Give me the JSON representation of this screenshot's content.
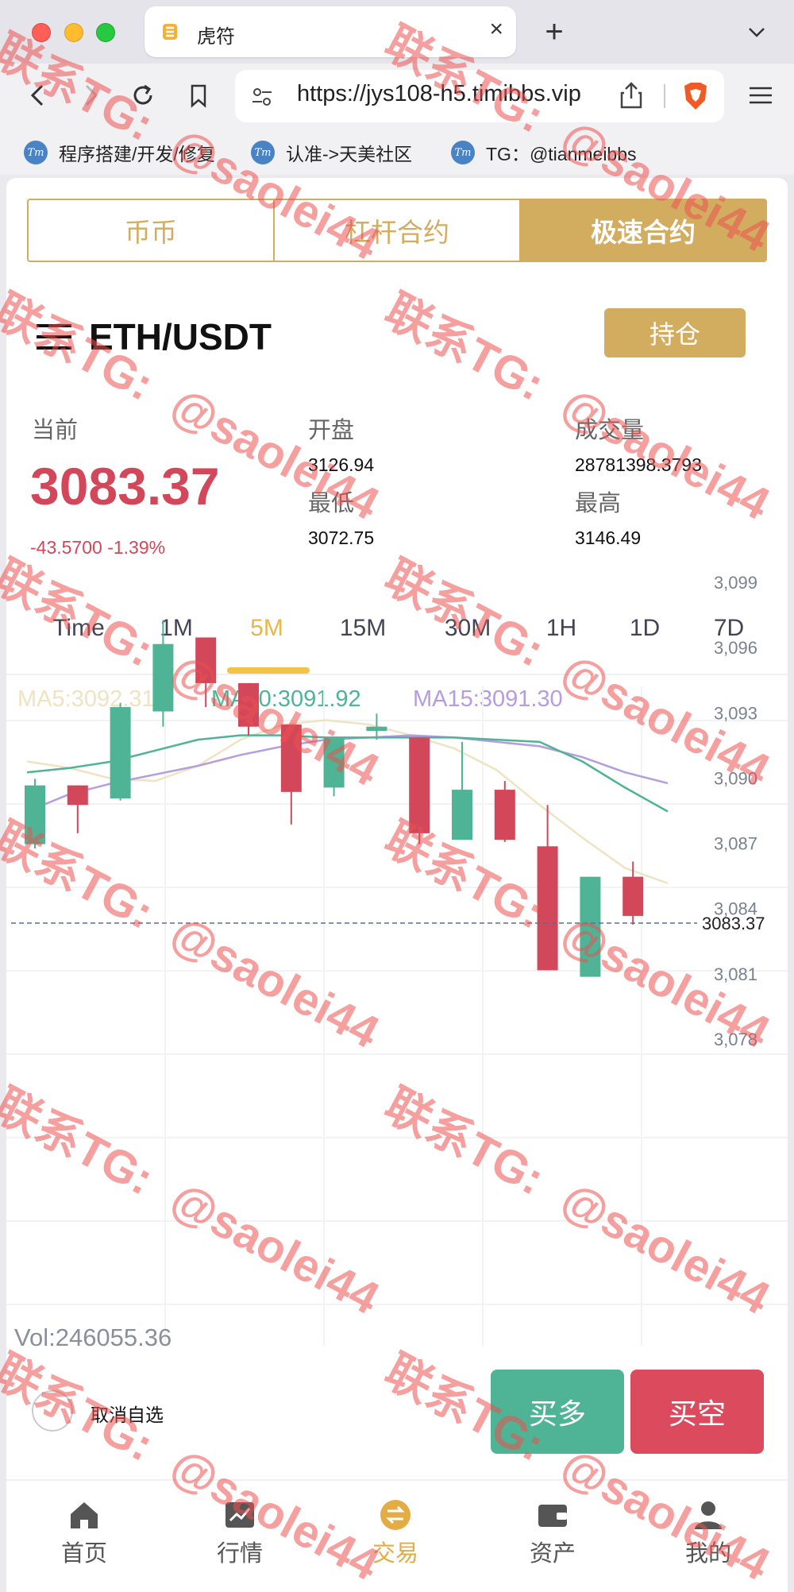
{
  "browser": {
    "tab_title": "虎符",
    "url": "https://jys108-h5.timibbs.vip",
    "bookmarks": [
      {
        "label": "程序搭建/开发/修复",
        "icon_text": "Tm"
      },
      {
        "label": "认准->天美社区",
        "icon_text": "Tm"
      },
      {
        "label": "TG：@tianmeibbs",
        "icon_text": "Tm"
      }
    ]
  },
  "segments": [
    {
      "label": "币币",
      "active": false
    },
    {
      "label": "杠杆合约",
      "active": false
    },
    {
      "label": "极速合约",
      "active": true
    }
  ],
  "pair": {
    "name": "ETH/USDT",
    "position_button": "持仓"
  },
  "quote": {
    "current_label": "当前",
    "price": "3083.37",
    "change": "-43.5700 -1.39%",
    "open_label": "开盘",
    "open": "3126.94",
    "volume_label": "成交量",
    "volume": "28781398.3793",
    "low_label": "最低",
    "low": "3072.75",
    "high_label": "最高",
    "high": "3146.49"
  },
  "timeframes": [
    "Time",
    "1M",
    "5M",
    "15M",
    "30M",
    "1H",
    "1D",
    "7D"
  ],
  "active_timeframe": "5M",
  "ma": {
    "ma5": "MA5:3092.31",
    "ma10": "MA10:3091.92",
    "ma15": "MA15:3091.30"
  },
  "colors": {
    "gold": "#d3ad5f",
    "up": "#4fb496",
    "down": "#d24759",
    "ma5": "#efe3c2",
    "ma10": "#4fb496",
    "ma15": "#b69ce0"
  },
  "chart_data": {
    "type": "candlestick",
    "y_ticks": [
      "3,099",
      "3,096",
      "3,093",
      "3,090",
      "3,087",
      "3,084",
      "3,081",
      "3,078"
    ],
    "ylim": [
      3078,
      3099
    ],
    "current_price_label": "3083.37",
    "current_price": 3083.37,
    "candles": [
      {
        "o": 3087.0,
        "c": 3089.7,
        "h": 3090.0,
        "l": 3086.8
      },
      {
        "o": 3089.7,
        "c": 3088.8,
        "h": 3089.7,
        "l": 3087.5
      },
      {
        "o": 3089.1,
        "c": 3093.3,
        "h": 3093.5,
        "l": 3089.0
      },
      {
        "o": 3093.1,
        "c": 3096.2,
        "h": 3097.3,
        "l": 3092.4
      },
      {
        "o": 3096.5,
        "c": 3094.4,
        "h": 3096.5,
        "l": 3093.3
      },
      {
        "o": 3094.4,
        "c": 3092.4,
        "h": 3094.4,
        "l": 3092.0
      },
      {
        "o": 3092.5,
        "c": 3089.4,
        "h": 3092.5,
        "l": 3087.9
      },
      {
        "o": 3089.6,
        "c": 3091.9,
        "h": 3091.9,
        "l": 3089.2
      },
      {
        "o": 3092.2,
        "c": 3092.4,
        "h": 3093.0,
        "l": 3091.8
      },
      {
        "o": 3091.9,
        "c": 3087.5,
        "h": 3091.9,
        "l": 3087.0
      },
      {
        "o": 3087.2,
        "c": 3089.5,
        "h": 3091.7,
        "l": 3087.2
      },
      {
        "o": 3089.5,
        "c": 3087.2,
        "h": 3089.9,
        "l": 3087.1
      },
      {
        "o": 3086.9,
        "c": 3081.2,
        "h": 3088.8,
        "l": 3081.2
      },
      {
        "o": 3080.9,
        "c": 3085.5,
        "h": 3085.5,
        "l": 3080.9
      },
      {
        "o": 3085.5,
        "c": 3083.7,
        "h": 3086.2,
        "l": 3083.3
      }
    ],
    "ma5": [
      3090.8,
      3090.5,
      3090.0,
      3089.9,
      3090.6,
      3091.8,
      3092.5,
      3092.7,
      3092.5,
      3092.0,
      3091.4,
      3090.4,
      3088.8,
      3087.3,
      3085.9,
      3085.2
    ],
    "ma10": [
      3090.3,
      3090.5,
      3090.8,
      3091.3,
      3091.8,
      3092.0,
      3092.0,
      3091.9,
      3091.9,
      3091.9,
      3091.9,
      3091.8,
      3091.7,
      3090.8,
      3089.6,
      3088.5
    ],
    "ma15": [
      3088.5,
      3089.3,
      3089.8,
      3090.2,
      3090.6,
      3091.1,
      3091.5,
      3091.8,
      3091.9,
      3092.0,
      3091.9,
      3091.7,
      3091.5,
      3091.0,
      3090.3,
      3089.8
    ],
    "volume_label": "Vol:246055.36"
  },
  "favorite_label": "取消自选",
  "buy_label": "买多",
  "sell_label": "买空",
  "bottom_nav": [
    {
      "label": "首页",
      "icon": "home-icon",
      "active": false
    },
    {
      "label": "行情",
      "icon": "chart-icon",
      "active": false
    },
    {
      "label": "交易",
      "icon": "trade-icon",
      "active": true
    },
    {
      "label": "资产",
      "icon": "wallet-icon",
      "active": false
    },
    {
      "label": "我的",
      "icon": "user-icon",
      "active": false
    }
  ],
  "watermark": {
    "line1": "联系TG:",
    "line2": "@saolei44"
  }
}
